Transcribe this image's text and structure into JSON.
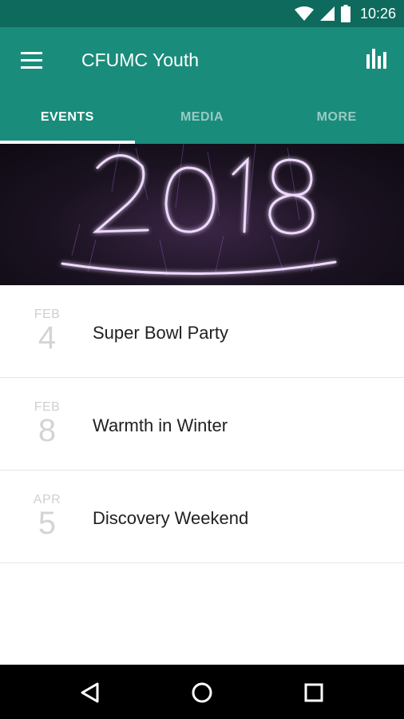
{
  "status_bar": {
    "time": "10:26"
  },
  "app_bar": {
    "title": "CFUMC Youth",
    "tabs": [
      {
        "label": "EVENTS",
        "active": true
      },
      {
        "label": "MEDIA",
        "active": false
      },
      {
        "label": "MORE",
        "active": false
      }
    ]
  },
  "banner": {
    "text": "2018"
  },
  "events": [
    {
      "month": "FEB",
      "day": "4",
      "title": "Super Bowl Party"
    },
    {
      "month": "FEB",
      "day": "8",
      "title": "Warmth in Winter"
    },
    {
      "month": "APR",
      "day": "5",
      "title": "Discovery Weekend"
    }
  ],
  "colors": {
    "status_bar": "#0e6a5c",
    "app_bar": "#1a8c7b",
    "banner_glow": "#e6c8ff"
  },
  "icons": {
    "menu": "hamburger-icon",
    "chart": "bar-chart-icon",
    "wifi": "wifi-icon",
    "signal": "cell-signal-icon",
    "battery": "battery-icon",
    "back": "back-triangle-icon",
    "home": "home-circle-icon",
    "recents": "recents-square-icon"
  }
}
